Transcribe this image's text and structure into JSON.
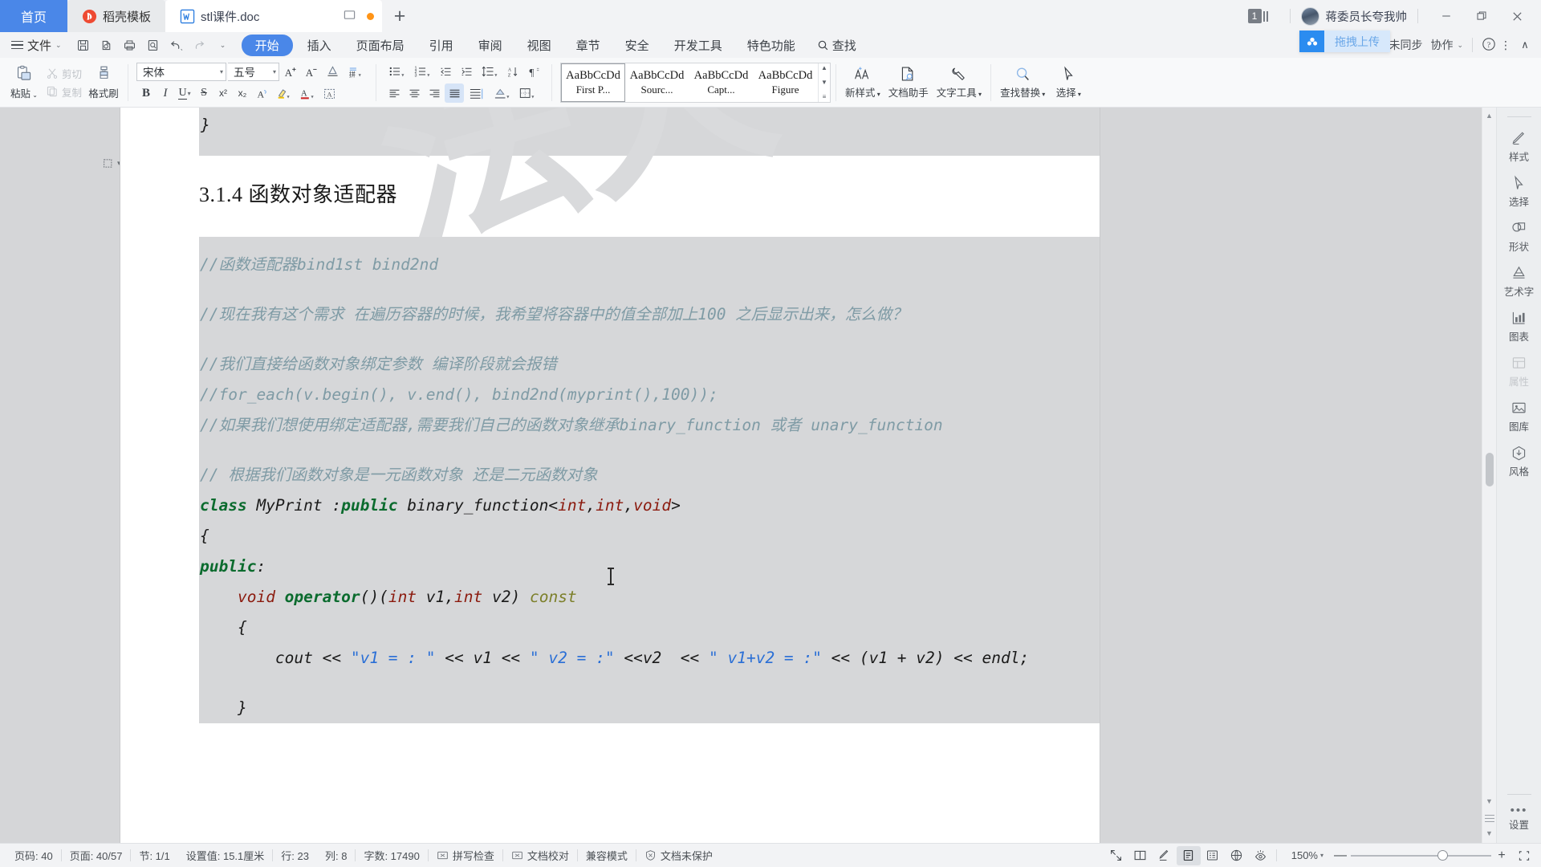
{
  "titlebar": {
    "tabs": [
      {
        "label": "首页",
        "icon": "home-tab"
      },
      {
        "label": "稻壳模板",
        "icon": "docer-logo-icon"
      },
      {
        "label": "stl课件.doc",
        "icon": "word-doc-icon"
      }
    ],
    "new_tab_label": "+",
    "notification_count": "1",
    "user_name": "蒋委员长夸我帅",
    "minimize": "—",
    "restore": "❐",
    "close": "✕"
  },
  "ribbon": {
    "file_label": "文件",
    "quick_icons": [
      "save-icon",
      "print-preview-icon",
      "print-icon",
      "search-doc-icon",
      "undo-icon",
      "redo-icon",
      "customize-qat-icon"
    ],
    "tabs": [
      {
        "label": "开始",
        "active": true
      },
      {
        "label": "插入",
        "active": false
      },
      {
        "label": "页面布局",
        "active": false
      },
      {
        "label": "引用",
        "active": false
      },
      {
        "label": "审阅",
        "active": false
      },
      {
        "label": "视图",
        "active": false
      },
      {
        "label": "章节",
        "active": false
      },
      {
        "label": "安全",
        "active": false
      },
      {
        "label": "开发工具",
        "active": false
      },
      {
        "label": "特色功能",
        "active": false
      }
    ],
    "find_label": "查找",
    "sync_status": "未同步",
    "cloud_label": "协作",
    "help_label": "?",
    "more_label": "⋮",
    "collapse_label": "∧"
  },
  "format_toolbar": {
    "paste_label": "粘贴",
    "cut_label": "剪切",
    "copy_label": "复制",
    "format_painter_label": "格式刷",
    "font_name": "宋体",
    "font_size": "五号",
    "grow_font": "A⁺",
    "shrink_font": "A⁻",
    "clear_format": "clear-format-icon",
    "pinyin_label": "拼",
    "bold": "B",
    "italic": "I",
    "underline": "U",
    "strikethrough": "S",
    "superscript": "x²",
    "subscript": "x₂",
    "text_effects": "A",
    "highlight": "highlighter-icon",
    "font_color": "font-color-icon",
    "char_border": "char-border-icon",
    "styles_label": "新样式",
    "doc_assistant_label": "文档助手",
    "text_tools_label": "文字工具",
    "find_replace_label": "查找替换",
    "select_label": "选择",
    "gallery": [
      {
        "sample": "AaBbCcDd",
        "name": "First P...",
        "selected": true
      },
      {
        "sample": "AaBbCcDd",
        "name": "Sourc...",
        "selected": false
      },
      {
        "sample": "AaBbCcDd",
        "name": "Capt...",
        "selected": false
      },
      {
        "sample": "AaBbCcDd",
        "name": "Figure",
        "selected": false
      }
    ]
  },
  "document": {
    "watermark_text": "法大",
    "heading": "3.1.4  函数对象适配器",
    "brace_before": "}",
    "code_lines": [
      {
        "kind": "comment",
        "text": "//函数适配器bind1st bind2nd"
      },
      {
        "kind": "blank",
        "text": ""
      },
      {
        "kind": "comment",
        "text": "//现在我有这个需求 在遍历容器的时候，我希望将容器中的值全部加上100 之后显示出来，怎么做？"
      },
      {
        "kind": "blank",
        "text": ""
      },
      {
        "kind": "comment",
        "text": "//我们直接给函数对象绑定参数 编译阶段就会报错"
      },
      {
        "kind": "comment",
        "text": "//for_each(v.begin(), v.end(), bind2nd(myprint(),100));"
      },
      {
        "kind": "comment",
        "text": "//如果我们想使用绑定适配器,需要我们自己的函数对象继承binary_function 或者 unary_function"
      },
      {
        "kind": "blank",
        "text": ""
      },
      {
        "kind": "comment",
        "text": "// 根据我们函数对象是一元函数对象 还是二元函数对象"
      },
      {
        "kind": "code_class",
        "text": "class MyPrint :public binary_function<int,int,void>"
      },
      {
        "kind": "plain",
        "text": "{"
      },
      {
        "kind": "code_public",
        "text": "public:"
      },
      {
        "kind": "code_operator",
        "text": "    void operator()(int v1,int v2) const"
      },
      {
        "kind": "plain",
        "text": "    {"
      },
      {
        "kind": "code_cout",
        "text": "        cout << \"v1 = : \" << v1 << \" v2 = :\" <<v2  << \" v1+v2 = :\" << (v1 + v2) << endl;"
      },
      {
        "kind": "blank",
        "text": ""
      },
      {
        "kind": "plain",
        "text": "    }"
      }
    ]
  },
  "right_sidebar": {
    "items": [
      {
        "label": "样式",
        "icon": "pen-style-icon",
        "disabled": false
      },
      {
        "label": "选择",
        "icon": "cursor-select-icon",
        "disabled": false
      },
      {
        "label": "形状",
        "icon": "shapes-icon",
        "disabled": false
      },
      {
        "label": "艺术字",
        "icon": "wordart-icon",
        "disabled": false
      },
      {
        "label": "图表",
        "icon": "chart-bar-icon",
        "disabled": false
      },
      {
        "label": "属性",
        "icon": "properties-icon",
        "disabled": true
      },
      {
        "label": "图库",
        "icon": "image-gallery-icon",
        "disabled": false
      },
      {
        "label": "风格",
        "icon": "theme-style-icon",
        "disabled": false
      },
      {
        "label": "设置",
        "icon": "settings-dots-icon",
        "disabled": false
      }
    ]
  },
  "statusbar": {
    "page_number_label": "页码: 40",
    "page_count_label": "页面: 40/57",
    "section_label": "节: 1/1",
    "setting_value_label": "设置值: 15.1厘米",
    "row_label": "行: 23",
    "col_label": "列: 8",
    "word_count_label": "字数: 17490",
    "spellcheck_label": "拼写检查",
    "proofread_label": "文档校对",
    "compat_label": "兼容模式",
    "protection_label": "文档未保护",
    "view_buttons": [
      "fullscreen-icon",
      "two-page-icon",
      "edit-pen-icon",
      "page-view-icon",
      "outline-view-icon",
      "web-view-icon",
      "eye-protect-icon"
    ],
    "active_view": "page-view-icon",
    "zoom_label": "150%",
    "zoom_out": "—",
    "zoom_in": "+",
    "fit_label": "fit-page-icon"
  },
  "upload_tooltip": {
    "label": "拖拽上传",
    "icon": "cloud-upload-icon",
    "accent": "#2b8cf0"
  }
}
